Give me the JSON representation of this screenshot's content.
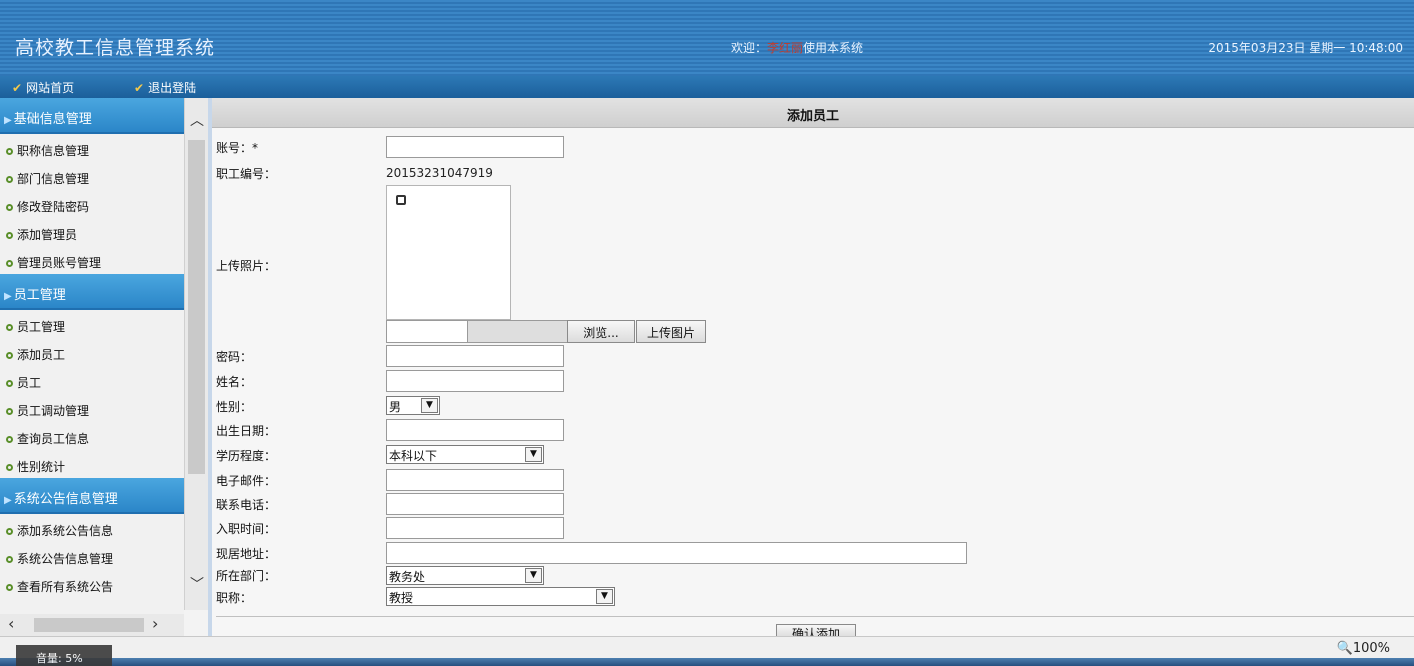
{
  "header": {
    "app_title": "高校教工信息管理系统",
    "welcome_prefix": "欢迎：",
    "username": "李红丽",
    "welcome_suffix": "使用本系统",
    "datetime": "2015年03月23日 星期一 10:48:00"
  },
  "nav": {
    "home": "网站首页",
    "logout": "退出登陆"
  },
  "sidebar": {
    "sections": [
      {
        "title": "基础信息管理",
        "items": [
          "职称信息管理",
          "部门信息管理",
          "修改登陆密码",
          "添加管理员",
          "管理员账号管理"
        ]
      },
      {
        "title": "员工管理",
        "items": [
          "员工管理",
          "添加员工",
          "员工",
          "员工调动管理",
          "查询员工信息",
          "性别统计"
        ]
      },
      {
        "title": "系统公告信息管理",
        "items": [
          "添加系统公告信息",
          "系统公告信息管理",
          "查看所有系统公告"
        ]
      }
    ]
  },
  "form": {
    "title": "添加员工",
    "account_label": "账号：*",
    "account_value": "",
    "employee_no_label": "职工编号：",
    "employee_no_value": "20153231047919",
    "photo_label": "上传照片：",
    "browse_button": "浏览...",
    "upload_button": "上传图片",
    "password_label": "密码：",
    "name_label": "姓名：",
    "gender_label": "性别：",
    "gender_value": "男",
    "birthdate_label": "出生日期：",
    "education_label": "学历程度：",
    "education_value": "本科以下",
    "email_label": "电子邮件：",
    "phone_label": "联系电话：",
    "hire_date_label": "入职时间：",
    "address_label": "现居地址：",
    "department_label": "所在部门：",
    "department_value": "教务处",
    "title_label": "职称：",
    "title_value": "教授",
    "submit_button": "确认添加"
  },
  "statusbar": {
    "zoom": "100%",
    "volume": "音量: 5%"
  }
}
